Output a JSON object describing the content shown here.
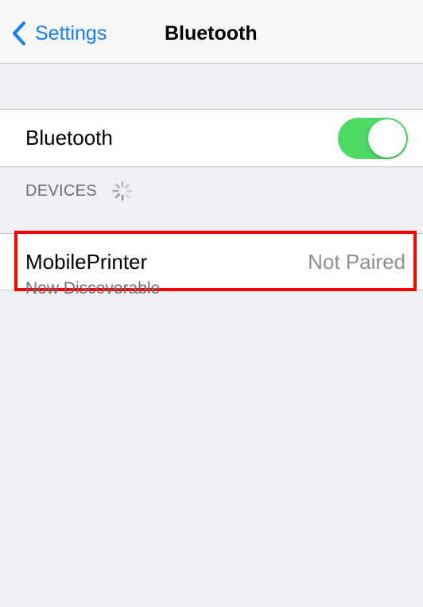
{
  "navbar": {
    "back_label": "Settings",
    "title": "Bluetooth",
    "back_icon": "chevron-left-icon"
  },
  "bluetooth": {
    "label": "Bluetooth",
    "enabled": true
  },
  "devices_section": {
    "header": "DEVICES",
    "spinner_icon": "activity-spinner-icon",
    "items": [
      {
        "name": "MobilePrinter",
        "status": "Not Paired"
      }
    ],
    "footer": "Now Discoverable"
  },
  "colors": {
    "accent": "#147efb",
    "toggle_on": "#4cd964",
    "background": "#efeff4",
    "highlight": "#ff0000",
    "secondary_text": "#8e8e93"
  }
}
